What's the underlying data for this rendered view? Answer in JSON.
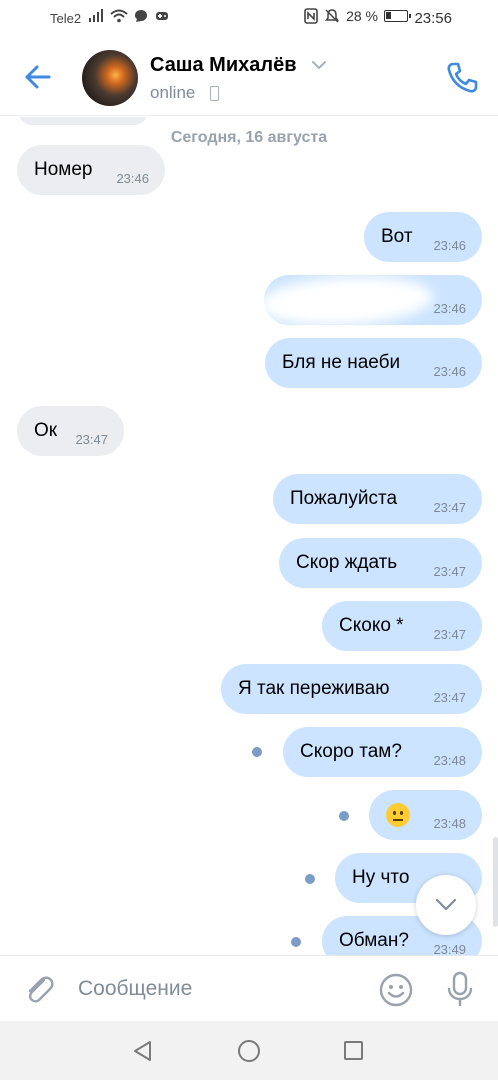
{
  "status_bar": {
    "carrier": "Tele2",
    "battery_percent": "28 %",
    "battery_level": 0.28,
    "time": "23:56"
  },
  "header": {
    "contact_name": "Саша Михалёв",
    "presence": "online"
  },
  "chat": {
    "date_separator": "Сегодня, 16 августа",
    "messages": [
      {
        "direction": "in",
        "text": "Номер",
        "time": "23:46"
      },
      {
        "direction": "out",
        "text": "Вот",
        "time": "23:46"
      },
      {
        "direction": "out",
        "text": "",
        "time": "23:46",
        "redacted": true
      },
      {
        "direction": "out",
        "text": "Бля не наеби",
        "time": "23:46"
      },
      {
        "direction": "in",
        "text": "Ок",
        "time": "23:47"
      },
      {
        "direction": "out",
        "text": "Пожалуйста",
        "time": "23:47"
      },
      {
        "direction": "out",
        "text": "Скор ждать",
        "time": "23:47"
      },
      {
        "direction": "out",
        "text": "Скоко *",
        "time": "23:47"
      },
      {
        "direction": "out",
        "text": "Я так переживаю",
        "time": "23:47"
      },
      {
        "direction": "out",
        "text": "Скоро там?",
        "time": "23:48",
        "unread": true
      },
      {
        "direction": "out",
        "text": "",
        "emoji": "neutral-face",
        "time": "23:48",
        "unread": true
      },
      {
        "direction": "out",
        "text": "Ну что",
        "time": "",
        "unread": true
      },
      {
        "direction": "out",
        "text": "Обман?",
        "time": "23:49",
        "unread": true
      }
    ]
  },
  "composer": {
    "placeholder": "Сообщение"
  },
  "icons": {
    "back": "arrow-left-icon",
    "call": "phone-icon",
    "attach": "paperclip-icon",
    "emoji": "smile-icon",
    "mic": "microphone-icon",
    "scroll_down": "chevron-down-icon"
  },
  "colors": {
    "accent": "#3f8ae0",
    "incoming_bubble": "#ebedf0",
    "outgoing_bubble": "#cce4ff",
    "unread_dot": "#7a9cc6"
  }
}
